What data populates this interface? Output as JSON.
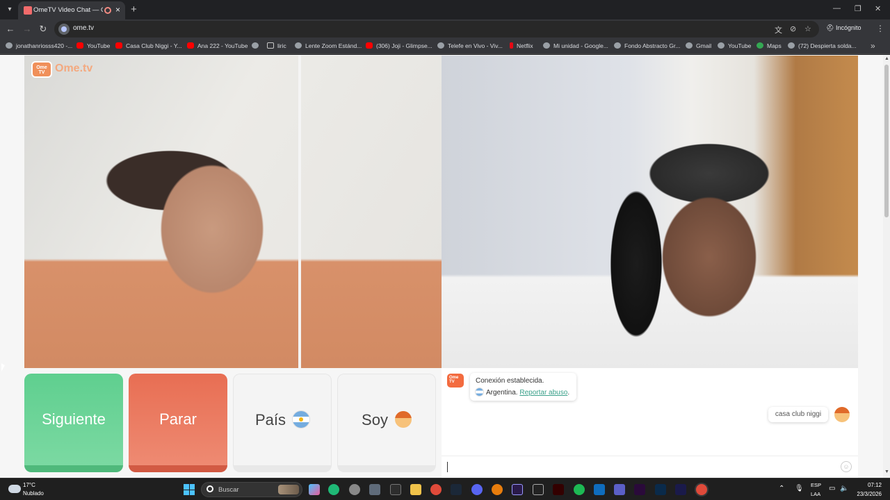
{
  "browser": {
    "tab_title": "OmeTV Video Chat — Ome",
    "url": "ome.tv",
    "incognito_label": "Incógnito"
  },
  "bookmarks": [
    {
      "label": "jonathanriosss420 -...",
      "icon": "globe-icon"
    },
    {
      "label": "YouTube",
      "icon": "youtube-icon"
    },
    {
      "label": "Casa Club Niggi - Y...",
      "icon": "youtube-icon"
    },
    {
      "label": "Ana 222 - YouTube",
      "icon": "youtube-icon"
    },
    {
      "label": "",
      "icon": "globe-icon"
    },
    {
      "label": "liric",
      "icon": "folder-icon"
    },
    {
      "label": "Lente Zoom Estánd...",
      "icon": "globe-icon"
    },
    {
      "label": "(306) Joji - Glimpse...",
      "icon": "youtube-icon"
    },
    {
      "label": "Telefe en Vivo - Viv...",
      "icon": "globe-icon"
    },
    {
      "label": "Netflix",
      "icon": "netflix-icon"
    },
    {
      "label": "Mi unidad - Google...",
      "icon": "drive-icon"
    },
    {
      "label": "Fondo Abstracto Gr...",
      "icon": "globe-icon"
    },
    {
      "label": "Gmail",
      "icon": "globe-icon"
    },
    {
      "label": "YouTube",
      "icon": "globe-icon"
    },
    {
      "label": "Maps",
      "icon": "maps-icon"
    },
    {
      "label": "(72) Despierta solda...",
      "icon": "globe-icon"
    }
  ],
  "omegle": {
    "logo_text": "Ome.tv",
    "logo_badge": "Ome TV",
    "buttons": {
      "next": "Siguiente",
      "stop": "Parar",
      "country": "País",
      "gender": "Soy"
    },
    "chat": {
      "avatar_badge": "Ome TV",
      "system_line1": "Conexión establecida.",
      "system_country": "Argentina.",
      "report_link": "Reportar abuso",
      "report_suffix": ".",
      "my_message": "casa club niggi"
    }
  },
  "taskbar": {
    "temperature": "17°C",
    "weather": "Nublado",
    "search_placeholder": "Buscar",
    "lang_line1": "ESP",
    "lang_line2": "LAA",
    "time": "07:12",
    "date": "23/3/2026"
  },
  "colors": {
    "next_green": "#5fcf8f",
    "stop_red": "#e86e53",
    "link_teal": "#3aa08a",
    "brand_orange": "#f36b3f"
  }
}
